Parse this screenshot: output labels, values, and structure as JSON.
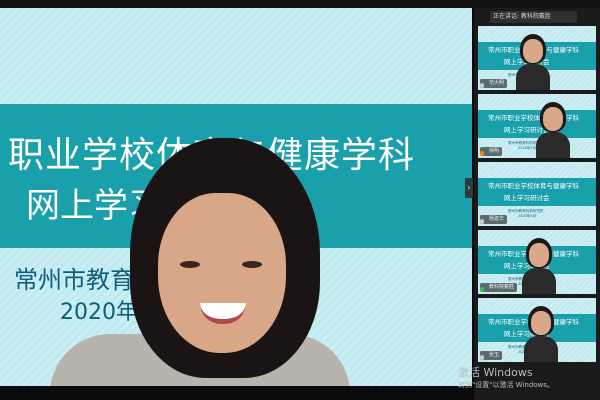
{
  "slide": {
    "title_line1": "职业学校体育与健康学科",
    "title_line2": "网上学习研讨会",
    "organizer": "常州市教育科学研究院",
    "date": "2020年5月"
  },
  "sidebar": {
    "speaking_label": "正在讲话: 教科院戴胜",
    "tiles": [
      {
        "name": "范大明",
        "line1": "常州市职业学校体育与健康学科",
        "line2": "网上学习研讨会",
        "org": "常州市教育科学研究院",
        "date": "2020年5月",
        "mic": "gray"
      },
      {
        "name": "徐明",
        "line1": "常州市职业学校体育与健康学科",
        "line2": "网上学习研讨会",
        "org": "常州市教育科学研究院",
        "date": "2020年5月",
        "mic": "orange"
      },
      {
        "name": "杨建华",
        "line1": "常州市职业学校体育与健康学科",
        "line2": "网上学习研讨会",
        "org": "常州市教育科学研究院",
        "date": "2020年5月",
        "mic": "gray"
      },
      {
        "name": "教科院戴胜",
        "line1": "常州市职业学校体育与健康学科",
        "line2": "网上学习研讨会",
        "org": "常州市教育科学研究院",
        "date": "2020年5月",
        "mic": "gray"
      },
      {
        "name": "张玉",
        "line1": "常州市职业学校体育与健康学科",
        "line2": "网上学习研讨会",
        "org": "常州市教育科学研究院",
        "date": "2020年5月",
        "mic": "gray"
      }
    ]
  },
  "watermark": {
    "line1": "激活 Windows",
    "line2": "转到\"设置\"以激活 Windows。"
  }
}
